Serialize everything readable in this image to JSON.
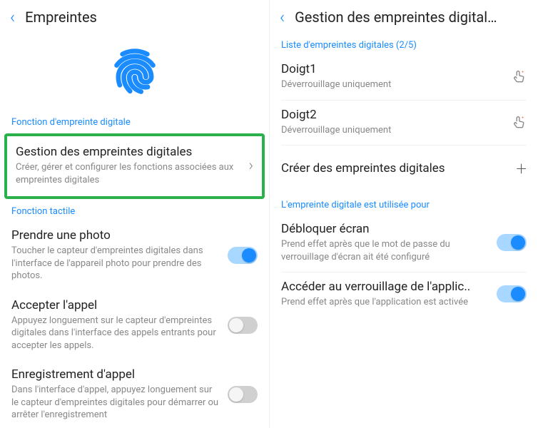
{
  "left": {
    "title": "Empreintes",
    "section_function": "Fonction d'empreinte digitale",
    "manage": {
      "title": "Gestion des empreintes digitales",
      "sub": "Créer, gérer et configurer les fonctions associées aux empreintes digitales"
    },
    "section_touch": "Fonction tactile",
    "photo": {
      "title": "Prendre une photo",
      "sub": "Toucher le capteur d'empreintes digitales dans l'interface de l'appareil photo pour prendre des photos."
    },
    "answer": {
      "title": "Accepter l'appel",
      "sub": "Appuyez longuement sur le capteur d'empreintes digitales dans l'interface des appels entrants pour accepter les appels."
    },
    "record": {
      "title": "Enregistrement d'appel",
      "sub": "Dans l'interface d'appel, appuyez longuement sur le capteur d'empreintes digitales pour démarrer ou arrêter l'enregistrement"
    }
  },
  "right": {
    "title": "Gestion des empreintes digital…",
    "list_label": "Liste d'empreintes digitales  (2/5)",
    "finger1": {
      "title": "Doigt1",
      "sub": "Déverrouillage uniquement"
    },
    "finger2": {
      "title": "Doigt2",
      "sub": "Déverrouillage uniquement"
    },
    "create": "Créer des empreintes digitales",
    "used_for": "L'empreinte digitale est utilisée pour",
    "unlock": {
      "title": "Débloquer écran",
      "sub": "Prend effet après que le mot de passe du verrouillage d'écran ait été configuré"
    },
    "applock": {
      "title": "Accéder au verrouillage de l'applic..",
      "sub": "Prend effet après que l'application est activée"
    }
  }
}
